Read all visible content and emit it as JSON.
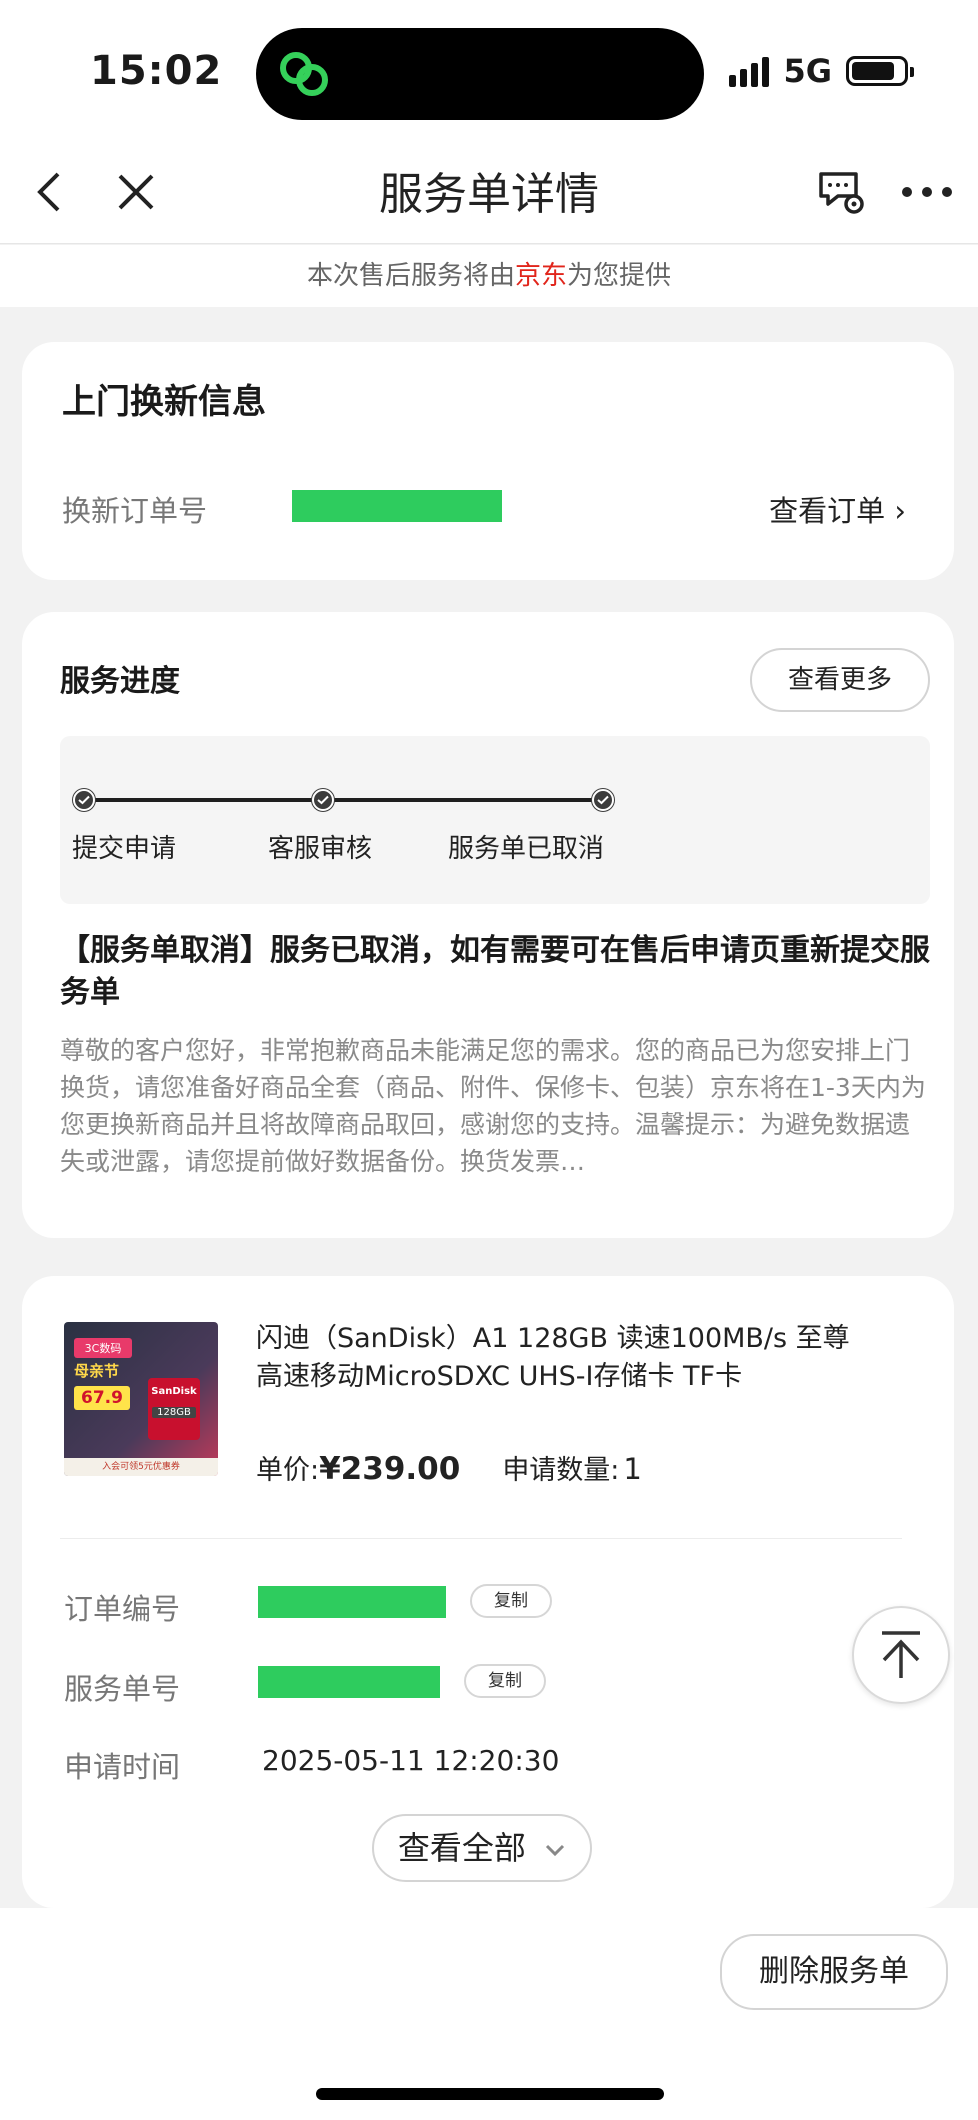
{
  "status_bar": {
    "time": "15:02",
    "network": "5G"
  },
  "nav": {
    "title": "服务单详情",
    "back_icon": "chevron-left-icon",
    "close_icon": "close-icon",
    "service_icon": "message-gear-icon",
    "more_icon": "more-dots-icon"
  },
  "provider": {
    "prefix": "本次售后服务将由",
    "brand": "京东",
    "suffix": "为您提供"
  },
  "exchange": {
    "title": "上门换新信息",
    "order_label": "换新订单号",
    "view_order": "查看订单 ›"
  },
  "progress": {
    "title": "服务进度",
    "more_button": "查看更多",
    "steps": [
      "提交申请",
      "客服审核",
      "服务单已取消"
    ],
    "cancel_title": "【服务单取消】服务已取消，如有需要可在售后申请页重新提交服务单",
    "cancel_body": "尊敬的客户您好，非常抱歉商品未能满足您的需求。您的商品已为您安排上门换货，请您准备好商品全套（商品、附件、保修卡、包装）京东将在1-3天内为您更换新商品并且将故障商品取回，感谢您的支持。温馨提示：为避免数据遗失或泄露，请您提前做好数据备份。换货发票…"
  },
  "product": {
    "name": "闪迪（SanDisk）A1 128GB 读速100MB/s 至尊高速移动MicroSDXC UHS-I存储卡 TF卡",
    "price_label": "单价:",
    "price": "¥239.00",
    "qty_label": "申请数量:",
    "qty": "1",
    "thumb_text": {
      "banner": "3C数码",
      "festival": "母亲节",
      "price": "67.9",
      "brand": "SanDisk",
      "capacity": "128GB",
      "footer": "入会可领5元优惠券"
    }
  },
  "order_info": {
    "order_no_label": "订单编号",
    "service_no_label": "服务单号",
    "copy_label": "复制",
    "apply_time_label": "申请时间",
    "apply_time": "2025-05-11 12:20:30",
    "view_all": "查看全部"
  },
  "footer": {
    "delete_button": "删除服务单"
  },
  "colors": {
    "accent_red": "#e1251b",
    "redaction_green": "#2ecc5e"
  }
}
